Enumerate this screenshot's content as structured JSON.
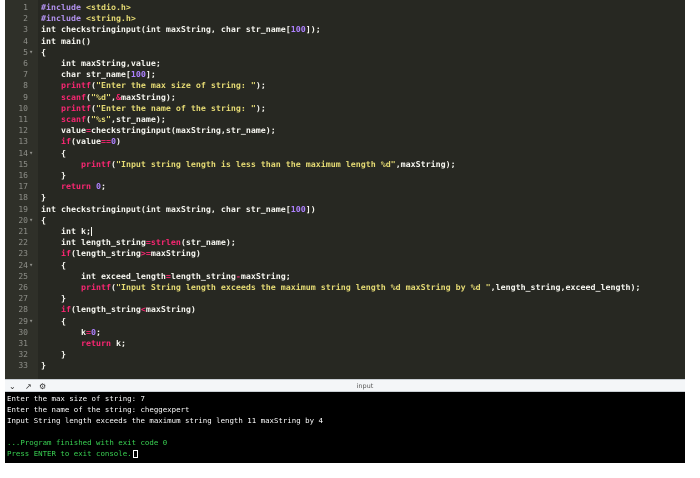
{
  "editor": {
    "lines": [
      {
        "n": "1",
        "fold": "",
        "segs": [
          [
            "p",
            "#include "
          ],
          [
            "s",
            "<stdio.h>"
          ]
        ]
      },
      {
        "n": "2",
        "fold": "",
        "segs": [
          [
            "p",
            "#include "
          ],
          [
            "s",
            "<string.h>"
          ]
        ]
      },
      {
        "n": "3",
        "fold": "",
        "segs": [
          [
            "k",
            "int checkstringinput(int maxString, char str_name["
          ],
          [
            "n",
            "100"
          ],
          [
            "k",
            "]);"
          ]
        ]
      },
      {
        "n": "4",
        "fold": "",
        "segs": [
          [
            "k",
            "int main()"
          ]
        ]
      },
      {
        "n": "5",
        "fold": "-",
        "segs": [
          [
            "k",
            "{"
          ]
        ]
      },
      {
        "n": "6",
        "fold": "",
        "segs": [
          [
            "k",
            "    int maxString,value;"
          ]
        ]
      },
      {
        "n": "7",
        "fold": "",
        "segs": [
          [
            "k",
            "    char str_name["
          ],
          [
            "n",
            "100"
          ],
          [
            "k",
            "];"
          ]
        ]
      },
      {
        "n": "8",
        "fold": "",
        "segs": [
          [
            "k",
            "    "
          ],
          [
            "f",
            "printf"
          ],
          [
            "k",
            "("
          ],
          [
            "s",
            "\"Enter the max size of string: \""
          ],
          [
            "k",
            ");"
          ]
        ]
      },
      {
        "n": "9",
        "fold": "",
        "segs": [
          [
            "k",
            "    "
          ],
          [
            "f",
            "scanf"
          ],
          [
            "k",
            "("
          ],
          [
            "s",
            "\"%d\""
          ],
          [
            "k",
            ","
          ],
          [
            "o",
            "&"
          ],
          [
            "k",
            "maxString);"
          ]
        ]
      },
      {
        "n": "10",
        "fold": "",
        "segs": [
          [
            "k",
            "    "
          ],
          [
            "f",
            "printf"
          ],
          [
            "k",
            "("
          ],
          [
            "s",
            "\"Enter the name of the string: \""
          ],
          [
            "k",
            ");"
          ]
        ]
      },
      {
        "n": "11",
        "fold": "",
        "segs": [
          [
            "k",
            "    "
          ],
          [
            "f",
            "scanf"
          ],
          [
            "k",
            "("
          ],
          [
            "s",
            "\"%s\""
          ],
          [
            "k",
            ",str_name);"
          ]
        ]
      },
      {
        "n": "12",
        "fold": "",
        "segs": [
          [
            "k",
            "    value"
          ],
          [
            "o",
            "="
          ],
          [
            "k",
            "checkstringinput(maxString,str_name);"
          ]
        ]
      },
      {
        "n": "13",
        "fold": "",
        "segs": [
          [
            "k",
            "    "
          ],
          [
            "f",
            "if"
          ],
          [
            "k",
            "(value"
          ],
          [
            "o",
            "=="
          ],
          [
            "n",
            "0"
          ],
          [
            "k",
            ")"
          ]
        ]
      },
      {
        "n": "14",
        "fold": "-",
        "segs": [
          [
            "k",
            "    {"
          ]
        ]
      },
      {
        "n": "15",
        "fold": "",
        "segs": [
          [
            "k",
            "        "
          ],
          [
            "f",
            "printf"
          ],
          [
            "k",
            "("
          ],
          [
            "s",
            "\"Input string length is less than the maximum length %d\""
          ],
          [
            "k",
            ",maxString);"
          ]
        ]
      },
      {
        "n": "16",
        "fold": "",
        "segs": [
          [
            "k",
            "    }"
          ]
        ]
      },
      {
        "n": "17",
        "fold": "",
        "segs": [
          [
            "k",
            "    "
          ],
          [
            "f",
            "return "
          ],
          [
            "n",
            "0"
          ],
          [
            "k",
            ";"
          ]
        ]
      },
      {
        "n": "18",
        "fold": "",
        "segs": [
          [
            "k",
            "}"
          ]
        ]
      },
      {
        "n": "19",
        "fold": "",
        "segs": [
          [
            "k",
            "int checkstringinput(int maxString, char str_name["
          ],
          [
            "n",
            "100"
          ],
          [
            "k",
            "])"
          ]
        ]
      },
      {
        "n": "20",
        "fold": "-",
        "segs": [
          [
            "k",
            "{"
          ]
        ]
      },
      {
        "n": "21",
        "fold": "",
        "segs": [
          [
            "k",
            "    int k;"
          ]
        ],
        "cursor": true
      },
      {
        "n": "22",
        "fold": "",
        "segs": [
          [
            "k",
            "    int length_string"
          ],
          [
            "o",
            "="
          ],
          [
            "f",
            "strlen"
          ],
          [
            "k",
            "(str_name);"
          ]
        ]
      },
      {
        "n": "23",
        "fold": "",
        "segs": [
          [
            "k",
            "    "
          ],
          [
            "f",
            "if"
          ],
          [
            "k",
            "(length_string"
          ],
          [
            "o",
            ">="
          ],
          [
            "k",
            "maxString)"
          ]
        ]
      },
      {
        "n": "24",
        "fold": "-",
        "segs": [
          [
            "k",
            "    {"
          ]
        ]
      },
      {
        "n": "25",
        "fold": "",
        "segs": [
          [
            "k",
            "        int exceed_length"
          ],
          [
            "o",
            "="
          ],
          [
            "k",
            "length_string"
          ],
          [
            "o",
            "-"
          ],
          [
            "k",
            "maxString;"
          ]
        ]
      },
      {
        "n": "26",
        "fold": "",
        "segs": [
          [
            "k",
            "        "
          ],
          [
            "f",
            "printf"
          ],
          [
            "k",
            "("
          ],
          [
            "s",
            "\"Input String length exceeds the maximum string length %d maxString by %d \""
          ],
          [
            "k",
            ",length_string,exceed_length);"
          ]
        ]
      },
      {
        "n": "27",
        "fold": "",
        "segs": [
          [
            "k",
            "    }"
          ]
        ]
      },
      {
        "n": "28",
        "fold": "",
        "segs": [
          [
            "k",
            "    "
          ],
          [
            "f",
            "if"
          ],
          [
            "k",
            "(length_string"
          ],
          [
            "o",
            "<"
          ],
          [
            "k",
            "maxString)"
          ]
        ]
      },
      {
        "n": "29",
        "fold": "-",
        "segs": [
          [
            "k",
            "    {"
          ]
        ]
      },
      {
        "n": "30",
        "fold": "",
        "segs": [
          [
            "k",
            "        k"
          ],
          [
            "o",
            "="
          ],
          [
            "n",
            "0"
          ],
          [
            "k",
            ";"
          ]
        ]
      },
      {
        "n": "31",
        "fold": "",
        "segs": [
          [
            "k",
            "        "
          ],
          [
            "f",
            "return"
          ],
          [
            "k",
            " k;"
          ]
        ]
      },
      {
        "n": "32",
        "fold": "",
        "segs": [
          [
            "k",
            "    }"
          ]
        ]
      },
      {
        "n": "33",
        "fold": "",
        "segs": [
          [
            "k",
            "}"
          ]
        ]
      }
    ]
  },
  "divider": {
    "label": "input",
    "icons": [
      "chevron-down-icon",
      "expand-icon",
      "settings-icon"
    ]
  },
  "console": {
    "lines": [
      {
        "text": "Enter the max size of string: 7",
        "style": ""
      },
      {
        "text": "Enter the name of the string: cheggexpert",
        "style": ""
      },
      {
        "text": "Input String length exceeds the maximum string length 11 maxString by 4",
        "style": ""
      },
      {
        "text": "",
        "style": ""
      },
      {
        "text": "...Program finished with exit code 0",
        "style": "green"
      },
      {
        "text": "Press ENTER to exit console.",
        "style": "green",
        "cursor": true
      }
    ]
  },
  "colors": {
    "editor_bg": "#272822",
    "keyword": "#f92672",
    "string": "#e6db74",
    "number": "#ae81ff",
    "console_bg": "#000000",
    "console_green": "#39d353"
  }
}
